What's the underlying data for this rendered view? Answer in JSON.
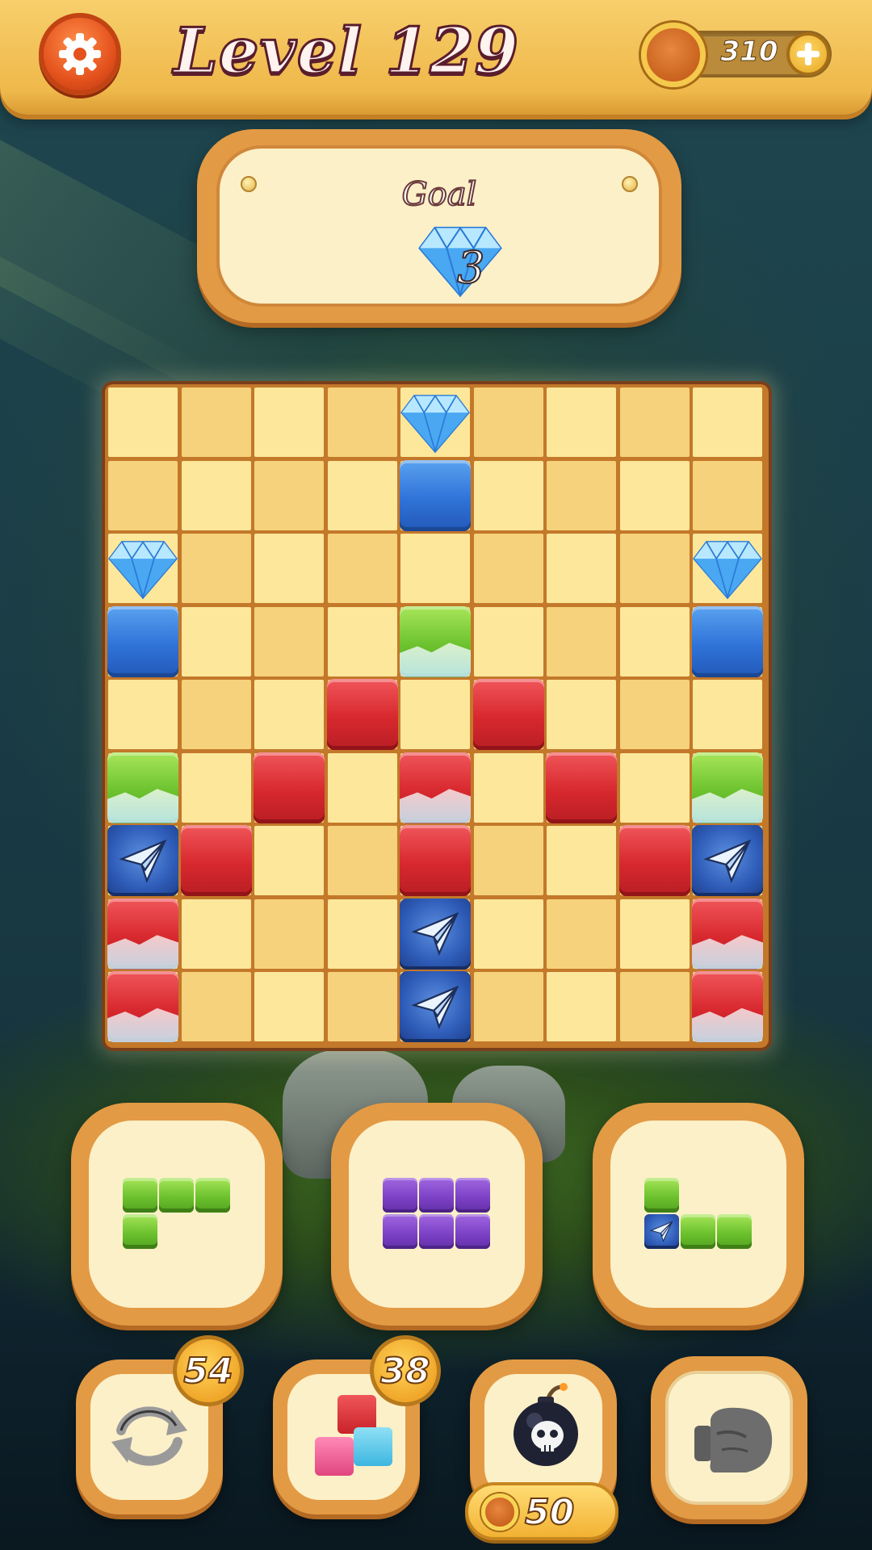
{
  "header": {
    "level_title": "Level 129",
    "coins": "310"
  },
  "goal": {
    "label": "Goal",
    "item_icon": "diamond-icon",
    "count": "3"
  },
  "board": {
    "columns": 9,
    "rows": 9,
    "pieces": [
      {
        "row": 0,
        "col": 4,
        "type": "diamond"
      },
      {
        "row": 1,
        "col": 4,
        "type": "blue"
      },
      {
        "row": 2,
        "col": 0,
        "type": "diamond"
      },
      {
        "row": 2,
        "col": 8,
        "type": "diamond"
      },
      {
        "row": 3,
        "col": 0,
        "type": "blue"
      },
      {
        "row": 3,
        "col": 4,
        "type": "green-ice"
      },
      {
        "row": 3,
        "col": 8,
        "type": "blue"
      },
      {
        "row": 4,
        "col": 3,
        "type": "red"
      },
      {
        "row": 4,
        "col": 5,
        "type": "red"
      },
      {
        "row": 5,
        "col": 0,
        "type": "green-ice"
      },
      {
        "row": 5,
        "col": 2,
        "type": "red"
      },
      {
        "row": 5,
        "col": 4,
        "type": "red-ice"
      },
      {
        "row": 5,
        "col": 6,
        "type": "red"
      },
      {
        "row": 5,
        "col": 8,
        "type": "green-ice"
      },
      {
        "row": 6,
        "col": 0,
        "type": "plane"
      },
      {
        "row": 6,
        "col": 1,
        "type": "red"
      },
      {
        "row": 6,
        "col": 4,
        "type": "red"
      },
      {
        "row": 6,
        "col": 7,
        "type": "red"
      },
      {
        "row": 6,
        "col": 8,
        "type": "plane"
      },
      {
        "row": 7,
        "col": 0,
        "type": "red-ice"
      },
      {
        "row": 7,
        "col": 4,
        "type": "plane"
      },
      {
        "row": 7,
        "col": 8,
        "type": "red-ice"
      },
      {
        "row": 8,
        "col": 0,
        "type": "red-ice"
      },
      {
        "row": 8,
        "col": 4,
        "type": "plane"
      },
      {
        "row": 8,
        "col": 8,
        "type": "red-ice"
      }
    ]
  },
  "next_pieces": [
    {
      "color": "green",
      "cells": [
        [
          0,
          0
        ],
        [
          0,
          1
        ],
        [
          0,
          2
        ],
        [
          1,
          0
        ]
      ]
    },
    {
      "color": "purple",
      "cells": [
        [
          0,
          0
        ],
        [
          0,
          1
        ],
        [
          0,
          2
        ],
        [
          1,
          0
        ],
        [
          1,
          1
        ],
        [
          1,
          2
        ]
      ]
    },
    {
      "color": "green",
      "cells": [
        [
          0,
          0
        ],
        [
          1,
          0,
          "plane"
        ],
        [
          1,
          1
        ],
        [
          1,
          2
        ]
      ]
    }
  ],
  "powerups": [
    {
      "name": "refresh",
      "icon": "refresh-arrows-icon",
      "count": "54"
    },
    {
      "name": "single-block",
      "icon": "blocks-icon",
      "count": "38"
    },
    {
      "name": "bomb",
      "icon": "skull-bomb-icon",
      "cost": "50"
    },
    {
      "name": "punch",
      "icon": "boxing-glove-icon"
    }
  ],
  "colors": {
    "blue": "#2f73d8",
    "red": "#d7282e",
    "green": "#6cc22e",
    "purple": "#7a3fc4",
    "panel_orange": "#e39a44",
    "panel_cream": "#fcf0c8"
  }
}
